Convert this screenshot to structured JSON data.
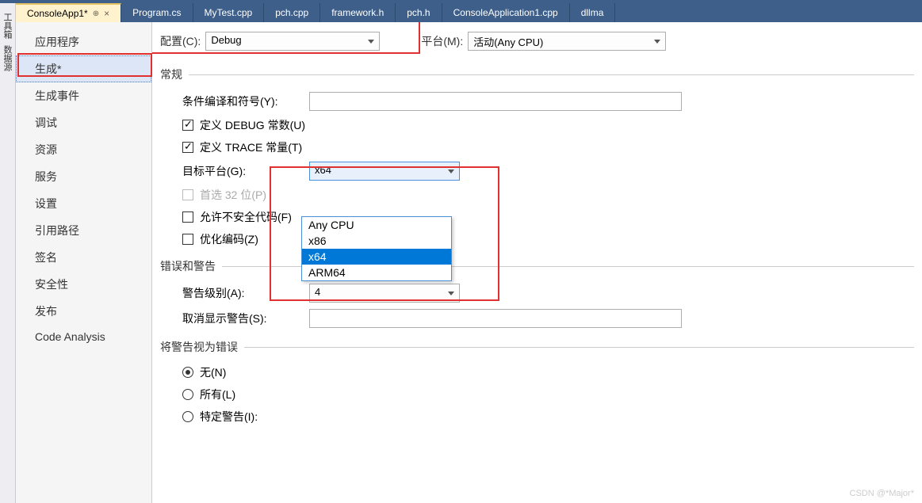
{
  "tabs": [
    {
      "label": "ConsoleApp1*",
      "active": true
    },
    {
      "label": "Program.cs"
    },
    {
      "label": "MyTest.cpp"
    },
    {
      "label": "pch.cpp"
    },
    {
      "label": "framework.h"
    },
    {
      "label": "pch.h"
    },
    {
      "label": "ConsoleApplication1.cpp"
    },
    {
      "label": "dllma"
    }
  ],
  "tool_rail": [
    "工具箱",
    "数据源"
  ],
  "sidebar": {
    "items": [
      "应用程序",
      "生成*",
      "生成事件",
      "调试",
      "资源",
      "服务",
      "设置",
      "引用路径",
      "签名",
      "安全性",
      "发布",
      "Code Analysis"
    ],
    "selected_index": 1
  },
  "top": {
    "config_label": "配置(C):",
    "config_value": "Debug",
    "platform_label": "平台(M):",
    "platform_value": "活动(Any CPU)"
  },
  "sections": {
    "general": "常规",
    "errors": "错误和警告",
    "treat_as_error": "将警告视为错误"
  },
  "general": {
    "cond_symbols_label": "条件编译和符号(Y):",
    "cond_symbols_value": "",
    "define_debug": "定义 DEBUG 常数(U)",
    "define_trace": "定义 TRACE 常量(T)",
    "target_platform_label": "目标平台(G):",
    "target_platform_value": "x64",
    "target_options": [
      "Any CPU",
      "x86",
      "x64",
      "ARM64"
    ],
    "target_selected_index": 2,
    "prefer_32": "首选 32 位(P)",
    "allow_unsafe": "允许不安全代码(F)",
    "optimize": "优化编码(Z)"
  },
  "errors": {
    "warn_level_label": "警告级别(A):",
    "warn_level_value": "4",
    "suppress_label": "取消显示警告(S):",
    "suppress_value": ""
  },
  "treat": {
    "none": "无(N)",
    "all": "所有(L)",
    "specific": "特定警告(I):"
  },
  "watermark": "CSDN @*Major*"
}
